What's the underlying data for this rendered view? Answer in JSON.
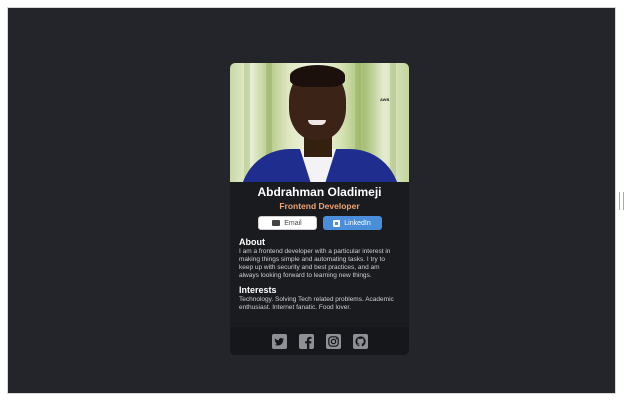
{
  "profile": {
    "name": "Abdrahman Oladimeji",
    "title": "Frontend Developer",
    "photo_tag": "AWB"
  },
  "buttons": {
    "email_label": "Email",
    "linkedin_label": "LinkedIn"
  },
  "about": {
    "heading": "About",
    "text": "I am a frontend developer with a particular interest in making things simple and automating tasks. I try to keep up with security and best practices, and am always looking forward to learning new things."
  },
  "interests": {
    "heading": "Interests",
    "text": "Technology. Solving Tech related problems. Academic enthusiast. Internet fanatic. Food lover."
  },
  "social": [
    "twitter-icon",
    "facebook-icon",
    "instagram-icon",
    "github-icon"
  ],
  "colors": {
    "page_bg": "#23252b",
    "card_bg": "#1a1b1f",
    "footer_bg": "#16171b",
    "title_accent": "#f0a46e",
    "linkedin_blue": "#4a8ed9",
    "icon_gray": "#8f9095"
  }
}
